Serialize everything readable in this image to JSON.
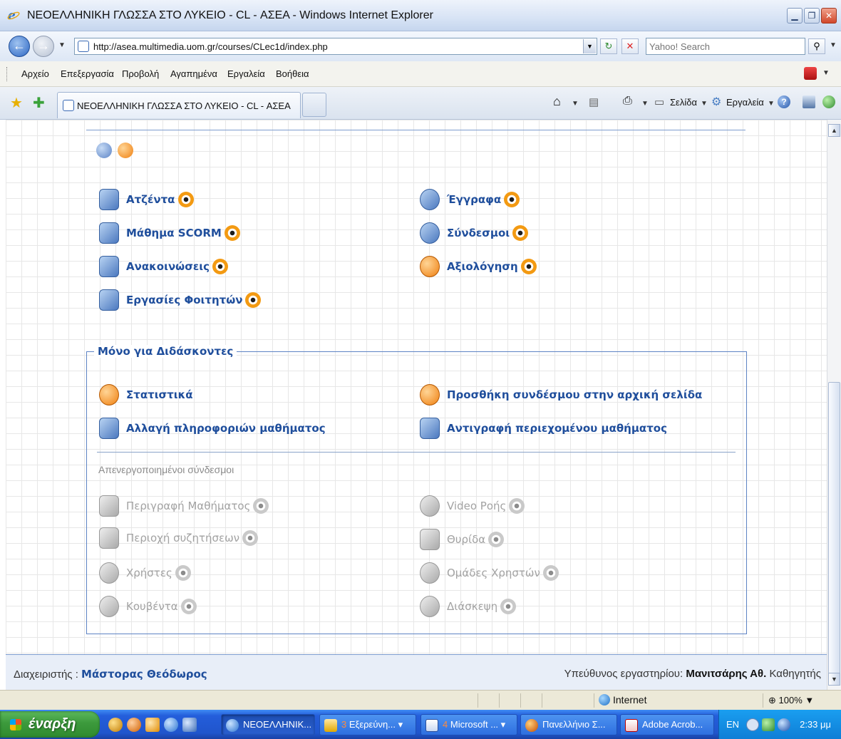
{
  "window": {
    "title": "ΝΕΟΕΛΛΗΝΙΚΗ ΓΛΩΣΣΑ ΣΤΟ ΛΥΚΕΙΟ - CL - ΑΣΕΑ - Windows Internet Explorer"
  },
  "address": {
    "url": "http://asea.multimedia.uom.gr/courses/CLec1d/index.php",
    "search_placeholder": "Yahoo! Search"
  },
  "menu": [
    "Αρχείο",
    "Επεξεργασία",
    "Προβολή",
    "Αγαπημένα",
    "Εργαλεία",
    "Βοήθεια"
  ],
  "tabs": {
    "active_label": "ΝΕΟΕΛΛΗΝΙΚΗ ΓΛΩΣΣΑ ΣΤΟ ΛΥΚΕΙΟ - CL - ΑΣΕΑ",
    "page_label": "Σελίδα",
    "tools_label": "Εργαλεία"
  },
  "tools": {
    "left": [
      {
        "label": "Ατζέντα",
        "icon": "agenda-icon"
      },
      {
        "label": "Μάθημα SCORM",
        "icon": "scorm-icon"
      },
      {
        "label": "Ανακοινώσεις",
        "icon": "announcements-icon"
      },
      {
        "label": "Εργασίες Φοιτητών",
        "icon": "assignments-icon"
      }
    ],
    "right": [
      {
        "label": "Έγγραφα",
        "icon": "documents-icon"
      },
      {
        "label": "Σύνδεσμοι",
        "icon": "links-icon"
      },
      {
        "label": "Αξιολόγηση",
        "icon": "evaluation-icon"
      }
    ]
  },
  "teachers": {
    "legend": "Μόνο για Διδάσκοντες",
    "items": [
      {
        "label": "Στατιστικά",
        "icon": "statistics-icon"
      },
      {
        "label": "Προσθήκη συνδέσμου στην αρχική σελίδα",
        "icon": "add-link-icon"
      },
      {
        "label": "Αλλαγή πληροφοριών μαθήματος",
        "icon": "course-info-icon"
      },
      {
        "label": "Αντιγραφή περιεχομένου μαθήματος",
        "icon": "copy-content-icon"
      }
    ],
    "disabled_heading": "Απενεργοποιημένοι σύνδεσμοι",
    "disabled_left": [
      {
        "label": "Περιγραφή Μαθήματος",
        "icon": "course-description-icon"
      },
      {
        "label": "Περιοχή συζητήσεων",
        "icon": "forum-icon"
      },
      {
        "label": "Χρήστες",
        "icon": "users-icon"
      },
      {
        "label": "Κουβέντα",
        "icon": "chat-icon"
      }
    ],
    "disabled_right": [
      {
        "label": "Video Ροής",
        "icon": "video-icon"
      },
      {
        "label": "Θυρίδα",
        "icon": "dropbox-icon"
      },
      {
        "label": "Ομάδες Χρηστών",
        "icon": "user-groups-icon"
      },
      {
        "label": "Διάσκεψη",
        "icon": "conference-icon"
      }
    ]
  },
  "footer": {
    "admin_label": "Διαχειριστής :",
    "admin_name": "Μάστορας Θεόδωρος",
    "lab_label": "Υπεύθυνος εργαστηρίου:",
    "lab_name": "Μανιτσάρης Αθ.",
    "lab_title": "Καθηγητής"
  },
  "status": {
    "zone": "Internet",
    "zoom": "100%"
  },
  "taskbar": {
    "start": "έναρξη",
    "buttons": [
      {
        "label": "ΝΕΟΕΛΛΗΝΙΚ...",
        "count": ""
      },
      {
        "label": "Εξερεύνη...",
        "count": "3"
      },
      {
        "label": "Microsoft ...",
        "count": "4"
      },
      {
        "label": "Πανελλήνιο Σ...",
        "count": ""
      },
      {
        "label": "Adobe Acrob...",
        "count": ""
      }
    ],
    "lang": "EN",
    "clock": "2:33 μμ"
  }
}
